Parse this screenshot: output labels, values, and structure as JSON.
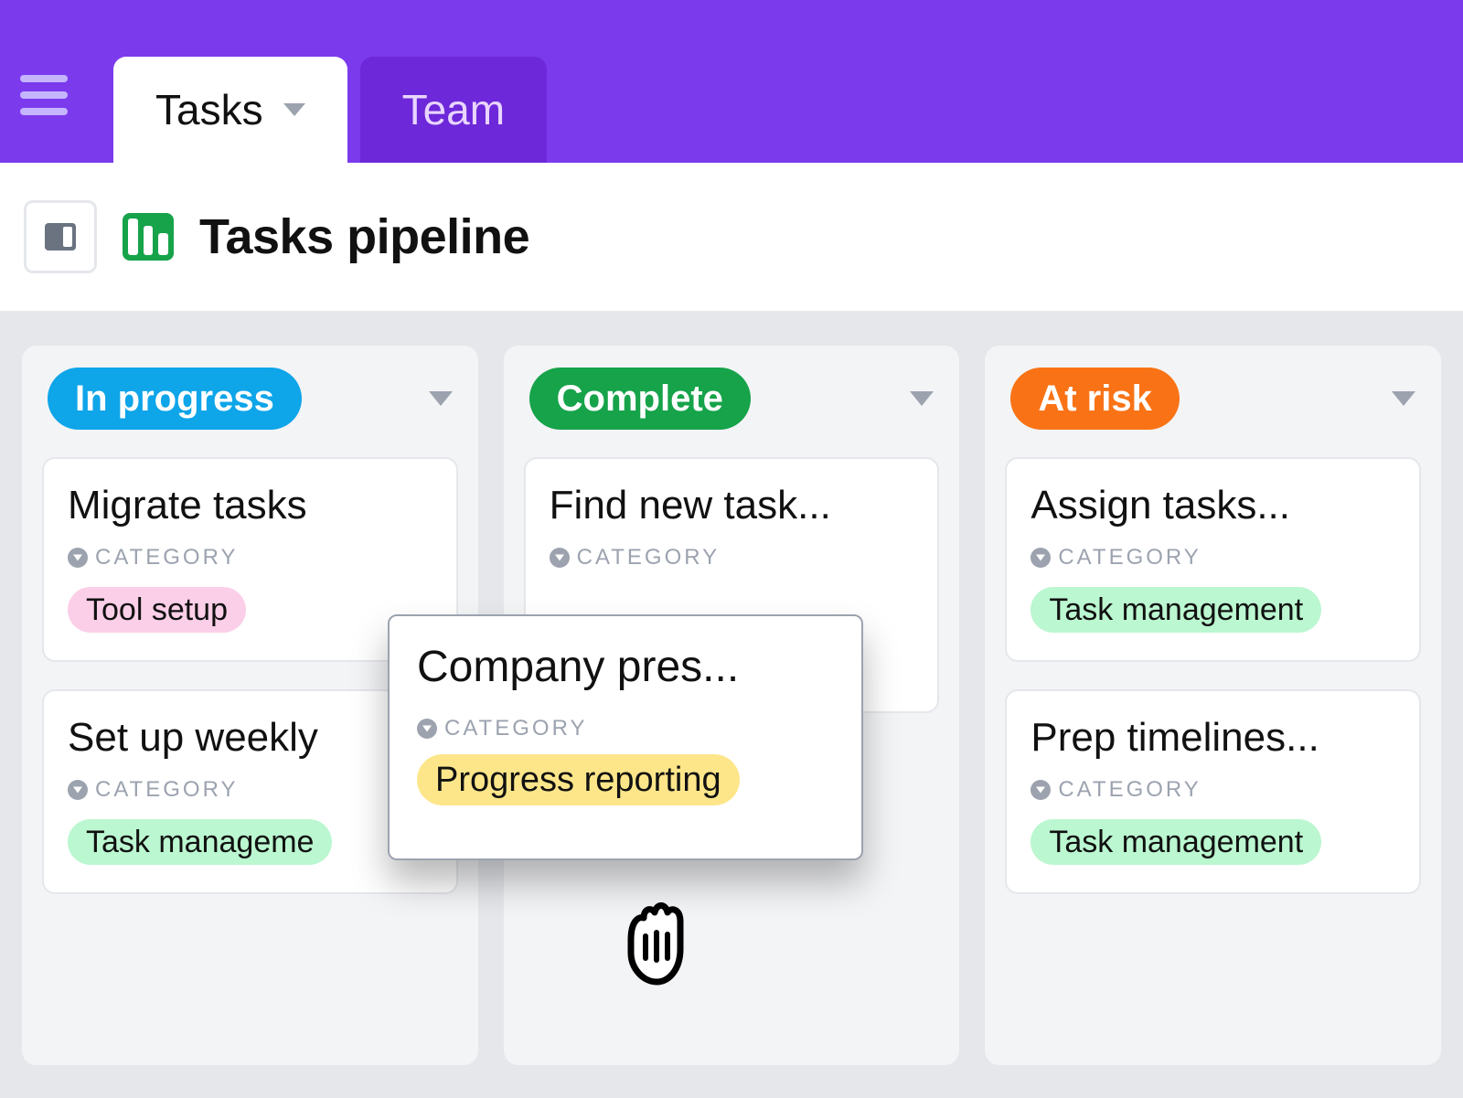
{
  "nav": {
    "tabs": [
      {
        "label": "Tasks",
        "active": true
      },
      {
        "label": "Team",
        "active": false
      }
    ]
  },
  "board": {
    "title": "Tasks pipeline",
    "meta_label": "CATEGORY"
  },
  "tag_colors": {
    "tool_setup": "#fbcfe8",
    "task_management": "#bbf7d0",
    "progress_reporting": "#fde68a"
  },
  "columns": [
    {
      "label": "In progress",
      "color": "#0ea5e9",
      "cards": [
        {
          "title": "Migrate tasks",
          "tag": "Tool setup",
          "tag_color_key": "tool_setup"
        },
        {
          "title": "Set up weekly",
          "tag": "Task manageme",
          "tag_color_key": "task_management"
        }
      ]
    },
    {
      "label": "Complete",
      "color": "#16a34a",
      "cards": [
        {
          "title": "Find new task...",
          "tag": "",
          "tag_color_key": "tool_setup"
        }
      ]
    },
    {
      "label": "At risk",
      "color": "#f97316",
      "cards": [
        {
          "title": "Assign tasks...",
          "tag": "Task management",
          "tag_color_key": "task_management"
        },
        {
          "title": "Prep timelines...",
          "tag": "Task management",
          "tag_color_key": "task_management"
        }
      ]
    }
  ],
  "dragging_card": {
    "title": "Company pres...",
    "tag": "Progress reporting",
    "tag_color_key": "progress_reporting"
  }
}
